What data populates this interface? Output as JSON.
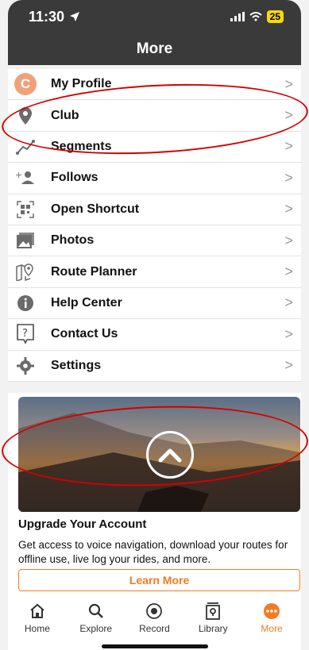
{
  "status_bar": {
    "time": "11:30",
    "battery": "25"
  },
  "header": {
    "title": "More"
  },
  "menu": {
    "items": [
      {
        "label": "My Profile",
        "avatar_letter": "C",
        "icon": "avatar-icon"
      },
      {
        "label": "Club",
        "icon": "location-pin-icon"
      },
      {
        "label": "Segments",
        "icon": "segments-icon"
      },
      {
        "label": "Follows",
        "icon": "add-person-icon"
      },
      {
        "label": "Open Shortcut",
        "icon": "qr-scan-icon"
      },
      {
        "label": "Photos",
        "icon": "photos-icon"
      },
      {
        "label": "Route Planner",
        "icon": "map-pin-icon"
      },
      {
        "label": "Help Center",
        "icon": "info-icon"
      },
      {
        "label": "Contact Us",
        "icon": "question-box-icon"
      },
      {
        "label": "Settings",
        "icon": "gear-icon"
      }
    ],
    "chevron": ">"
  },
  "promo": {
    "title": "Upgrade Your Account",
    "text": "Get access to voice navigation, download your routes for offline use, live log your rides, and more.",
    "button_label": "Learn More"
  },
  "tab_bar": {
    "tabs": [
      {
        "label": "Home",
        "icon": "home-icon"
      },
      {
        "label": "Explore",
        "icon": "search-icon"
      },
      {
        "label": "Record",
        "icon": "record-icon"
      },
      {
        "label": "Library",
        "icon": "library-icon"
      },
      {
        "label": "More",
        "icon": "more-icon",
        "active": true
      }
    ]
  },
  "colors": {
    "accent": "#f47b20",
    "header_bg": "#3a3a3a",
    "annotation": "#d40000"
  }
}
